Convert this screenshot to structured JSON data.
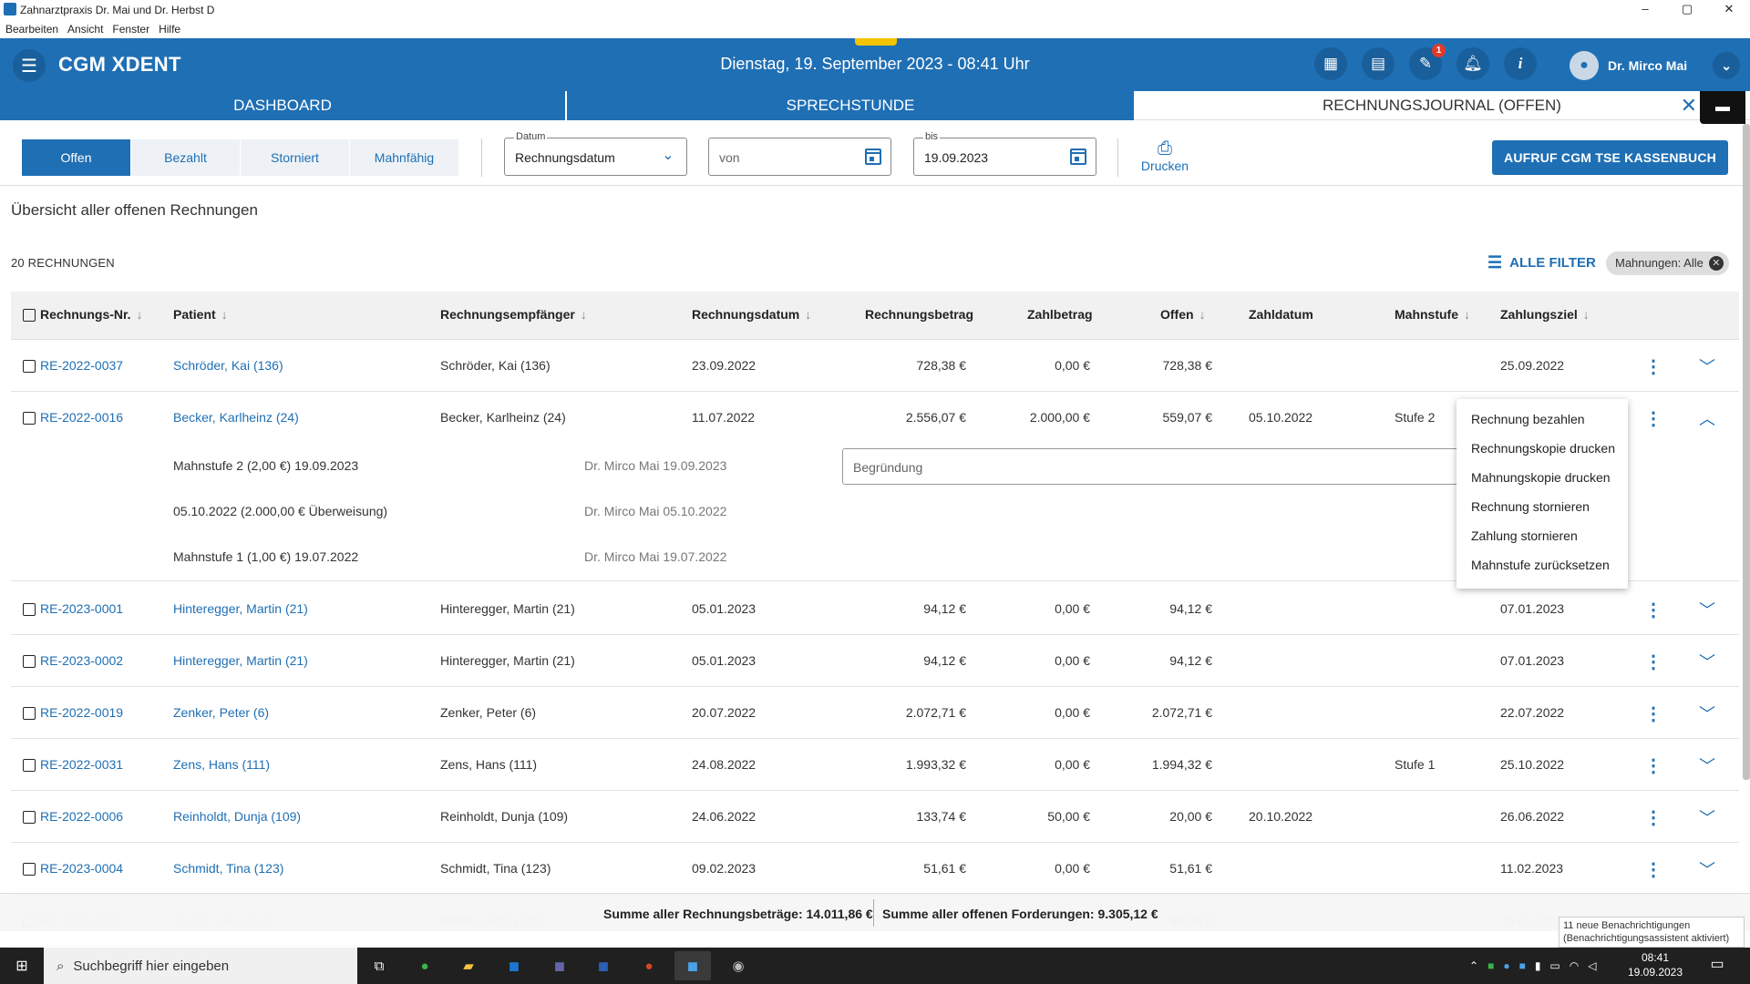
{
  "window": {
    "title": "Zahnarztpraxis Dr. Mai und Dr. Herbst D",
    "buttons": [
      "–",
      "▢",
      "✕"
    ]
  },
  "menubar": [
    "Bearbeiten",
    "Ansicht",
    "Fenster",
    "Hilfe"
  ],
  "appbar": {
    "brand": "CGM XDENT",
    "datetime": "Dienstag, 19. September 2023 - 08:41 Uhr",
    "user": "Dr. Mirco Mai",
    "notification_badge": "1"
  },
  "tabs": [
    {
      "label": "DASHBOARD"
    },
    {
      "label": "SPRECHSTUNDE"
    },
    {
      "label": "RECHNUNGSJOURNAL (OFFEN)"
    }
  ],
  "filterbar": {
    "segments": [
      "Offen",
      "Bezahlt",
      "Storniert",
      "Mahnfähig"
    ],
    "datum_label": "Datum",
    "datum_value": "Rechnungsdatum",
    "von_placeholder": "von",
    "bis_label": "bis",
    "bis_value": "19.09.2023",
    "print_label": "Drucken",
    "kasse_button": "AUFRUF CGM TSE KASSENBUCH"
  },
  "page_title": "Übersicht aller offenen Rechnungen",
  "count": "20 RECHNUNGEN",
  "all_filter": "ALLE FILTER",
  "chip": "Mahnungen: Alle",
  "columns": [
    "Rechnungs-Nr.",
    "Patient",
    "Rechnungsempfänger",
    "Rechnungsdatum",
    "Rechnungsbetrag",
    "Zahlbetrag",
    "Offen",
    "Zahldatum",
    "Mahnstufe",
    "Zahlungsziel"
  ],
  "rows": [
    {
      "nr": "RE-2022-0037",
      "patient": "Schröder, Kai (136)",
      "empf": "Schröder, Kai (136)",
      "datum": "23.09.2022",
      "betrag": "728,38 €",
      "zahl": "0,00 €",
      "offen": "728,38 €",
      "zahldatum": "",
      "mahn": "",
      "ziel": "25.09.2022"
    },
    {
      "nr": "RE-2022-0016",
      "patient": "Becker, Karlheinz (24)",
      "empf": "Becker, Karlheinz (24)",
      "datum": "11.07.2022",
      "betrag": "2.556,07 €",
      "zahl": "2.000,00 €",
      "offen": "559,07 €",
      "zahldatum": "05.10.2022",
      "mahn": "Stufe 2",
      "ziel": ""
    },
    {
      "nr": "RE-2023-0001",
      "patient": "Hinteregger, Martin (21)",
      "empf": "Hinteregger, Martin (21)",
      "datum": "05.01.2023",
      "betrag": "94,12 €",
      "zahl": "0,00 €",
      "offen": "94,12 €",
      "zahldatum": "",
      "mahn": "",
      "ziel": "07.01.2023"
    },
    {
      "nr": "RE-2023-0002",
      "patient": "Hinteregger, Martin (21)",
      "empf": "Hinteregger, Martin (21)",
      "datum": "05.01.2023",
      "betrag": "94,12 €",
      "zahl": "0,00 €",
      "offen": "94,12 €",
      "zahldatum": "",
      "mahn": "",
      "ziel": "07.01.2023"
    },
    {
      "nr": "RE-2022-0019",
      "patient": "Zenker, Peter (6)",
      "empf": "Zenker, Peter (6)",
      "datum": "20.07.2022",
      "betrag": "2.072,71 €",
      "zahl": "0,00 €",
      "offen": "2.072,71 €",
      "zahldatum": "",
      "mahn": "",
      "ziel": "22.07.2022"
    },
    {
      "nr": "RE-2022-0031",
      "patient": "Zens, Hans (111)",
      "empf": "Zens, Hans (111)",
      "datum": "24.08.2022",
      "betrag": "1.993,32 €",
      "zahl": "0,00 €",
      "offen": "1.994,32 €",
      "zahldatum": "",
      "mahn": "Stufe 1",
      "ziel": "25.10.2022"
    },
    {
      "nr": "RE-2022-0006",
      "patient": "Reinholdt, Dunja (109)",
      "empf": "Reinholdt, Dunja (109)",
      "datum": "24.06.2022",
      "betrag": "133,74 €",
      "zahl": "50,00 €",
      "offen": "20,00 €",
      "zahldatum": "20.10.2022",
      "mahn": "",
      "ziel": "26.06.2022"
    },
    {
      "nr": "RE-2023-0004",
      "patient": "Schmidt, Tina (123)",
      "empf": "Schmidt, Tina (123)",
      "datum": "09.02.2023",
      "betrag": "51,61 €",
      "zahl": "0,00 €",
      "offen": "51,61 €",
      "zahldatum": "",
      "mahn": "",
      "ziel": "11.02.2023"
    },
    {
      "nr": "RE-2023-0005",
      "patient": "Martin, Lang (115)",
      "empf": "Martin, Lang (115)",
      "datum": "",
      "betrag": "",
      "zahl": "",
      "offen": "94,93 €",
      "zahldatum": "",
      "mahn": "",
      "ziel": "15.02.2023"
    }
  ],
  "detail": [
    {
      "text": "Mahnstufe 2 (2,00 €) 19.09.2023",
      "by": "Dr. Mirco Mai 19.09.2023"
    },
    {
      "text": "05.10.2022 (2.000,00 € Überweisung)",
      "by": "Dr. Mirco Mai 05.10.2022"
    },
    {
      "text": "Mahnstufe 1 (1,00 €) 19.07.2022",
      "by": "Dr. Mirco Mai 19.07.2022"
    }
  ],
  "reason_placeholder": "Begründung",
  "context_menu": [
    "Rechnung bezahlen",
    "Rechnungskopie drucken",
    "Mahnungskopie drucken",
    "Rechnung stornieren",
    "Zahlung stornieren",
    "Mahnstufe zurücksetzen"
  ],
  "summary": {
    "total": "Summe aller Rechnungsbeträge: 14.011,86 €",
    "open": "Summe aller offenen Forderungen: 9.305,12 €"
  },
  "toast": {
    "line1": "11 neue Benachrichtigungen",
    "line2": "(Benachrichtigungsassistent aktiviert)"
  },
  "taskbar": {
    "search": "Suchbegriff hier eingeben",
    "time": "08:41",
    "date": "19.09.2023"
  }
}
